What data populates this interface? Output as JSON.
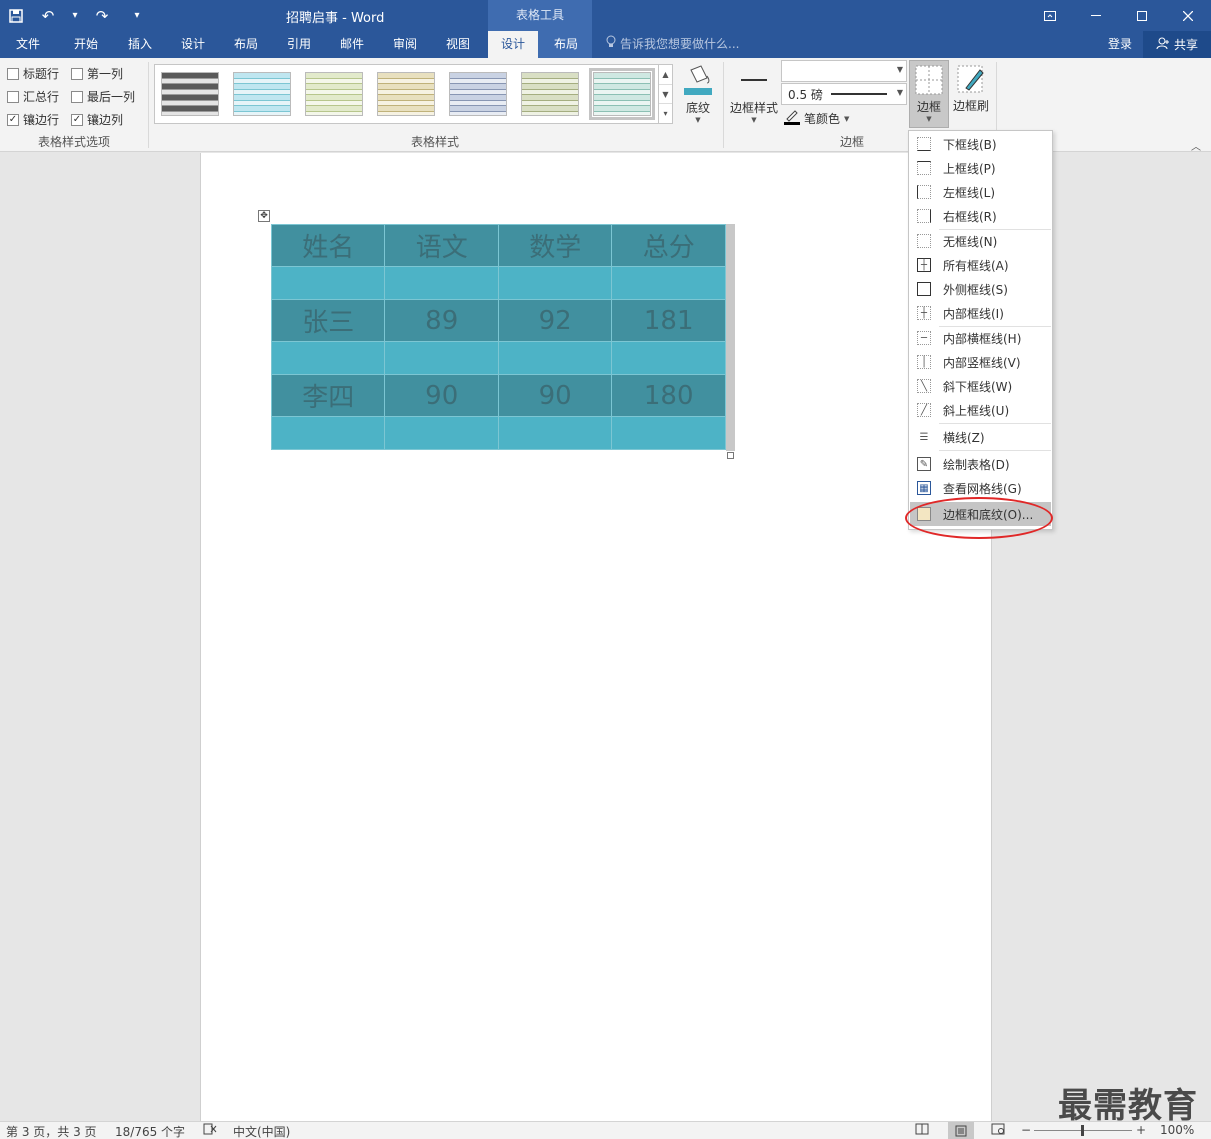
{
  "titlebar": {
    "doc_title": "招聘启事 - Word",
    "context_title": "表格工具",
    "qat_customize": "▾"
  },
  "tabs": {
    "file": "文件",
    "home": "开始",
    "insert": "插入",
    "design": "设计",
    "layout": "布局",
    "references": "引用",
    "mailings": "邮件",
    "review": "审阅",
    "view": "视图",
    "table_design": "设计",
    "table_layout": "布局",
    "tell_me": "告诉我您想要做什么...",
    "login": "登录",
    "share": "共享"
  },
  "ribbon": {
    "style_options": {
      "header_row": "标题行",
      "first_column": "第一列",
      "total_row": "汇总行",
      "last_column": "最后一列",
      "banded_rows": "镶边行",
      "banded_columns": "镶边列",
      "label": "表格样式选项",
      "checked": {
        "header_row": false,
        "first_column": false,
        "total_row": false,
        "last_column": false,
        "banded_rows": true,
        "banded_columns": true
      }
    },
    "table_styles": {
      "label": "表格样式",
      "shading": "底纹"
    },
    "borders": {
      "border_styles": "边框样式",
      "pen_weight": "0.5 磅",
      "pen_color": "笔颜色",
      "borders_btn": "边框",
      "border_painter": "边框刷",
      "label": "边框"
    }
  },
  "table": {
    "rows": [
      [
        "姓名",
        "语文",
        "数学",
        "总分"
      ],
      [
        "张三",
        "89",
        "92",
        "181"
      ],
      [
        "李四",
        "90",
        "90",
        "180"
      ]
    ]
  },
  "border_menu": {
    "items": [
      "下框线(B)",
      "上框线(P)",
      "左框线(L)",
      "右框线(R)",
      "无框线(N)",
      "所有框线(A)",
      "外侧框线(S)",
      "内部框线(I)",
      "内部横框线(H)",
      "内部竖框线(V)",
      "斜下框线(W)",
      "斜上框线(U)",
      "横线(Z)",
      "绘制表格(D)",
      "查看网格线(G)",
      "边框和底纹(O)..."
    ],
    "highlighted_index": 15
  },
  "statusbar": {
    "page": "第 3 页，共 3 页",
    "words": "18/765 个字",
    "language": "中文(中国)",
    "zoom": "100%"
  },
  "watermark": "最需教育",
  "colors": {
    "title_blue": "#2b579a",
    "context_blue": "#3f6cb0",
    "table_dark": "#41909f",
    "table_light": "#4db3c6",
    "annotation_red": "#e02828"
  }
}
